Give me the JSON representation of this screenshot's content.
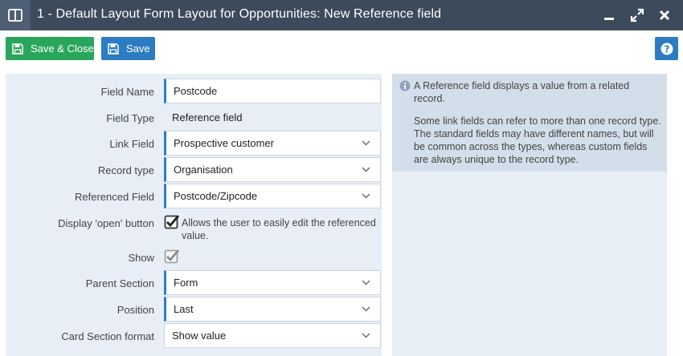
{
  "window": {
    "title": "1 - Default Layout Form Layout for Opportunities: New Reference field"
  },
  "toolbar": {
    "save_close_label": "Save & Close",
    "save_label": "Save"
  },
  "form": {
    "field_name": {
      "label": "Field Name",
      "value": "Postcode"
    },
    "field_type": {
      "label": "Field Type",
      "value": "Reference field"
    },
    "link_field": {
      "label": "Link Field",
      "value": "Prospective customer"
    },
    "record_type": {
      "label": "Record type",
      "value": "Organisation"
    },
    "referenced_field": {
      "label": "Referenced Field",
      "value": "Postcode/Zipcode"
    },
    "display_open": {
      "label": "Display 'open' button",
      "checked": true,
      "description": "Allows the user to easily edit the referenced value."
    },
    "show": {
      "label": "Show",
      "checked": true
    },
    "parent_section": {
      "label": "Parent Section",
      "value": "Form"
    },
    "position": {
      "label": "Position",
      "value": "Last"
    },
    "card_section_format": {
      "label": "Card Section format",
      "value": "Show value"
    }
  },
  "info": {
    "p1": "A Reference field displays a value from a related record.",
    "p2": "Some link fields can refer to more than one record type. The standard fields may have different names, but will be common across the types, whereas custom fields are always unique to the record type."
  },
  "colors": {
    "titlebar": "#3d4a5c",
    "save_close": "#2aa55c",
    "save": "#2c7cc2",
    "panel": "#e8eef6",
    "info_highlight": "#d3deeb"
  },
  "icons": {
    "layout": "panel-layout-icon",
    "minimize": "minimize-icon",
    "maximize": "maximize-icon",
    "close": "close-icon",
    "floppy": "floppy-disk-icon",
    "help": "question-icon",
    "info": "info-icon",
    "chevron": "chevron-down-icon",
    "check": "checkmark-icon"
  }
}
